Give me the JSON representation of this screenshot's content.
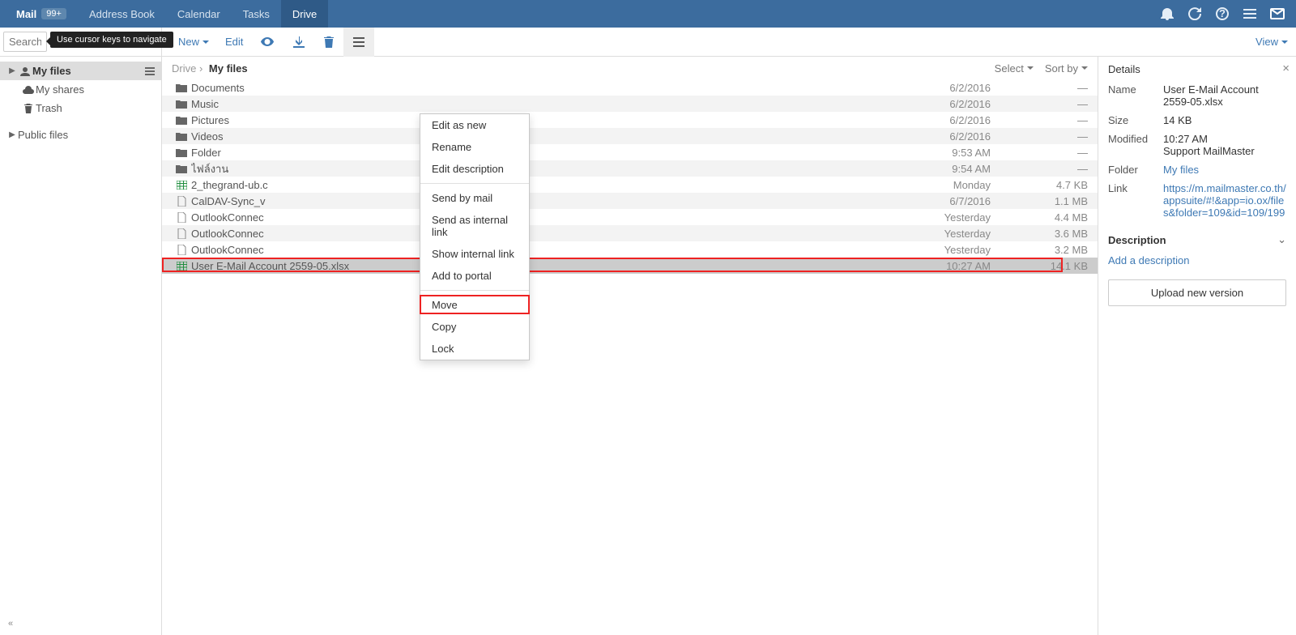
{
  "topnav": {
    "mail": "Mail",
    "mail_badge": "99+",
    "address_book": "Address Book",
    "calendar": "Calendar",
    "tasks": "Tasks",
    "drive": "Drive"
  },
  "search": {
    "placeholder": "Search...",
    "tooltip": "Use cursor keys to navigate"
  },
  "toolbar": {
    "new": "New",
    "edit": "Edit",
    "view": "View"
  },
  "sidebar": {
    "my_files": "My files",
    "my_shares": "My shares",
    "trash": "Trash",
    "public_files": "Public files"
  },
  "breadcrumb": {
    "root": "Drive",
    "current": "My files"
  },
  "listhead": {
    "select": "Select",
    "sort": "Sort by"
  },
  "files": [
    {
      "icon": "folder",
      "name": "Documents",
      "date": "6/2/2016",
      "size": "—"
    },
    {
      "icon": "folder",
      "name": "Music",
      "date": "6/2/2016",
      "size": "—"
    },
    {
      "icon": "folder",
      "name": "Pictures",
      "date": "6/2/2016",
      "size": "—"
    },
    {
      "icon": "folder",
      "name": "Videos",
      "date": "6/2/2016",
      "size": "—"
    },
    {
      "icon": "folder",
      "name": "Folder",
      "date": "9:53 AM",
      "size": "—"
    },
    {
      "icon": "folder",
      "name": "ไฟล์งาน",
      "date": "9:54 AM",
      "size": "—"
    },
    {
      "icon": "xls",
      "name": "2_thegrand-ub.c",
      "date": "Monday",
      "size": "4.7 KB"
    },
    {
      "icon": "file",
      "name": "CalDAV-Sync_v",
      "date": "6/7/2016",
      "size": "1.1 MB"
    },
    {
      "icon": "file",
      "name": "OutlookConnec",
      "date": "Yesterday",
      "size": "4.4 MB"
    },
    {
      "icon": "file",
      "name": "OutlookConnec",
      "date": "Yesterday",
      "size": "3.6 MB"
    },
    {
      "icon": "file",
      "name": "OutlookConnec",
      "date": "Yesterday",
      "size": "3.2 MB"
    },
    {
      "icon": "xls",
      "name": "User E-Mail Account 2559-05.xlsx",
      "date": "10:27 AM",
      "size": "14.1 KB"
    }
  ],
  "context_menu": {
    "edit_as_new": "Edit as new",
    "rename": "Rename",
    "edit_description": "Edit description",
    "send_by_mail": "Send by mail",
    "send_as_internal_link": "Send as internal link",
    "show_internal_link": "Show internal link",
    "add_to_portal": "Add to portal",
    "move": "Move",
    "copy": "Copy",
    "lock": "Lock"
  },
  "details": {
    "title": "Details",
    "name_label": "Name",
    "name_value": "User E-Mail Account 2559-05.xlsx",
    "size_label": "Size",
    "size_value": "14 KB",
    "modified_label": "Modified",
    "modified_time": "10:27 AM",
    "modified_by": "Support MailMaster",
    "folder_label": "Folder",
    "folder_value": "My files",
    "link_label": "Link",
    "link_value": "https://m.mailmaster.co.th/appsuite/#!&app=io.ox/files&folder=109&id=109/199",
    "description_label": "Description",
    "add_description": "Add a description",
    "upload": "Upload new version"
  }
}
